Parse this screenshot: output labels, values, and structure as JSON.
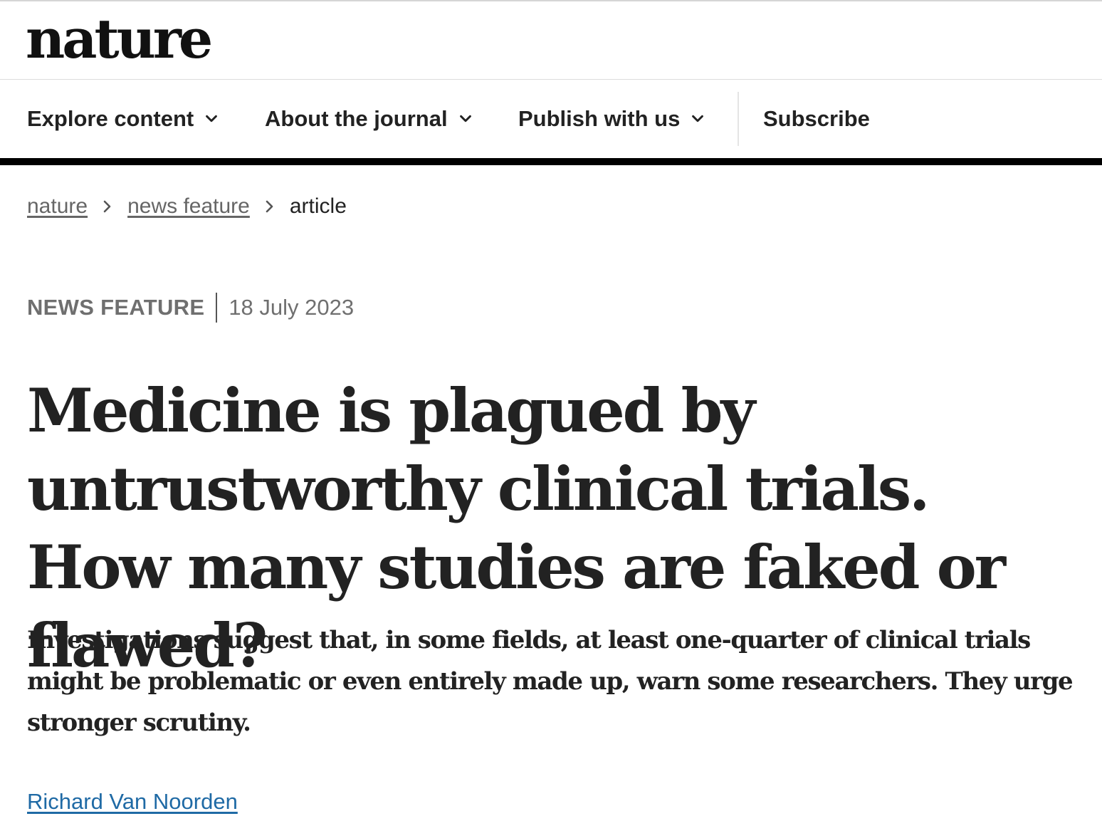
{
  "header": {
    "logo_text": "nature"
  },
  "nav": {
    "items": [
      {
        "label": "Explore content",
        "icon": "chevron-down-icon"
      },
      {
        "label": "About the journal",
        "icon": "chevron-down-icon"
      },
      {
        "label": "Publish with us",
        "icon": "chevron-down-icon"
      }
    ],
    "subscribe_label": "Subscribe"
  },
  "breadcrumb": {
    "items": [
      {
        "label": "nature"
      },
      {
        "label": "news feature"
      }
    ],
    "current": "article",
    "separator_icon": "chevron-right-icon"
  },
  "article": {
    "type": "NEWS FEATURE",
    "date": "18 July 2023",
    "title": "Medicine is plagued by untrustworthy clinical trials. How many studies are faked or flawed?",
    "standfirst": "Investigations suggest that, in some fields, at least one-quarter of clinical trials might be problematic or even entirely made up, warn some researchers. They urge stronger scrutiny.",
    "author": "Richard Van Noorden"
  },
  "colors": {
    "text": "#222222",
    "muted": "#6f6f6f",
    "link": "#1f6aa5",
    "nav_bar": "#000000"
  }
}
